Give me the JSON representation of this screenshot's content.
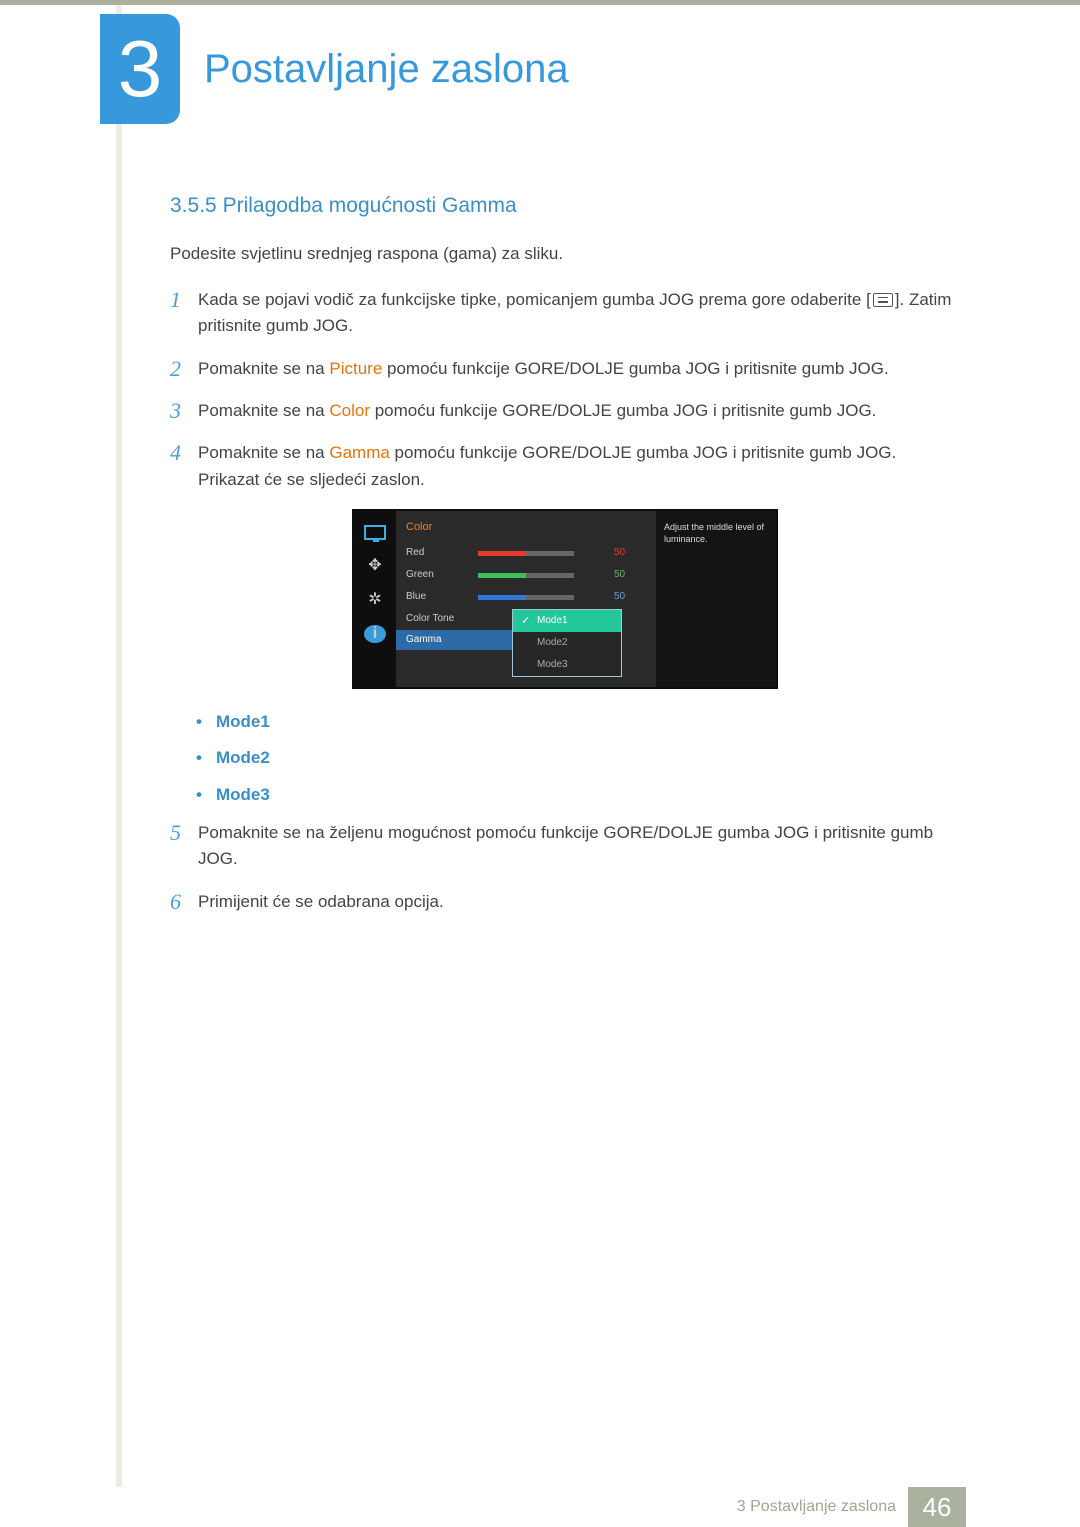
{
  "chapter": {
    "number": "3",
    "title": "Postavljanje zaslona"
  },
  "section": {
    "number": "3.5.5",
    "title": "Prilagodba mogućnosti Gamma"
  },
  "intro": "Podesite svjetlinu srednjeg raspona (gama) za sliku.",
  "steps": {
    "s1": {
      "num": "1",
      "pre": "Kada se pojavi vodič za funkcijske tipke, pomicanjem gumba JOG prema gore odaberite [",
      "post": "]. Zatim pritisnite gumb JOG."
    },
    "s2": {
      "num": "2",
      "pre": "Pomaknite se na ",
      "term": "Picture",
      "post": " pomoću funkcije GORE/DOLJE gumba JOG i pritisnite gumb JOG."
    },
    "s3": {
      "num": "3",
      "pre": "Pomaknite se na ",
      "term": "Color",
      "post": " pomoću funkcije GORE/DOLJE gumba JOG i pritisnite gumb JOG."
    },
    "s4": {
      "num": "4",
      "pre": "Pomaknite se na ",
      "term": "Gamma",
      "post": " pomoću funkcije GORE/DOLJE gumba JOG i pritisnite gumb JOG. Prikazat će se sljedeći zaslon."
    },
    "s5": {
      "num": "5",
      "text": "Pomaknite se na željenu mogućnost pomoću funkcije GORE/DOLJE gumba JOG i pritisnite gumb JOG."
    },
    "s6": {
      "num": "6",
      "text": "Primijenit će se odabrana opcija."
    }
  },
  "osd": {
    "menu_title": "Color",
    "rows": {
      "red": {
        "label": "Red",
        "value": "50",
        "fill": 50,
        "color": "#e33b2e"
      },
      "green": {
        "label": "Green",
        "value": "50",
        "fill": 50,
        "color": "#3fbf5b"
      },
      "blue": {
        "label": "Blue",
        "value": "50",
        "fill": 50,
        "color": "#3176d8"
      }
    },
    "color_tone": "Color Tone",
    "gamma_label": "Gamma",
    "dropdown": {
      "mode1": "Mode1",
      "mode2": "Mode2",
      "mode3": "Mode3"
    },
    "help": "Adjust the middle level of luminance."
  },
  "mode_bullets": {
    "m1": "Mode1",
    "m2": "Mode2",
    "m3": "Mode3"
  },
  "footer": {
    "text": "3 Postavljanje zaslona",
    "page": "46"
  },
  "chart_data": {
    "type": "bar",
    "title": "Color",
    "categories": [
      "Red",
      "Green",
      "Blue"
    ],
    "values": [
      50,
      50,
      50
    ],
    "ylim": [
      0,
      100
    ],
    "note": "Horizontal sliders in OSD; each channel at 50/100."
  }
}
